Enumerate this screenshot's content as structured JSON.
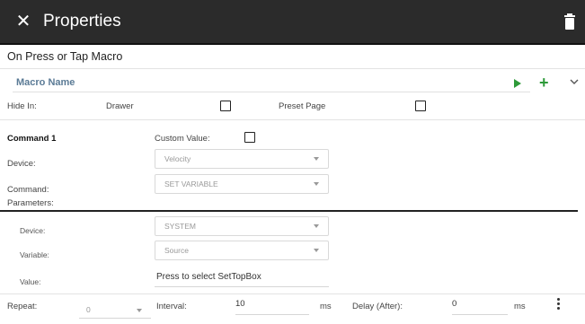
{
  "header": {
    "title": "Properties",
    "close_icon": "close-icon",
    "delete_icon": "trash-icon"
  },
  "section": {
    "title": "On Press or Tap Macro"
  },
  "macro": {
    "name_label": "Macro Name",
    "run_icon": "play-icon",
    "add_icon": "plus-icon",
    "expand_icon": "chevron-down-icon",
    "colors": {
      "label": "#5b7b96",
      "actions": "#2e9a39"
    }
  },
  "hide_in": {
    "label": "Hide In:",
    "drawer_label": "Drawer",
    "preset_label": "Preset Page",
    "drawer_checked": false,
    "preset_checked": false
  },
  "command": {
    "title": "Command 1",
    "custom_value_label": "Custom Value:",
    "custom_value_checked": false,
    "device_label": "Device:",
    "device_value": "Velocity",
    "command_label": "Command:",
    "command_value": "SET VARIABLE",
    "parameters_label": "Parameters:"
  },
  "parameters": {
    "device_label": "Device:",
    "device_value": "SYSTEM",
    "variable_label": "Variable:",
    "variable_value": "Source",
    "value_label": "Value:",
    "value_value": "Press to select SetTopBox"
  },
  "timing": {
    "repeat_label": "Repeat:",
    "repeat_value": "0",
    "interval_label": "Interval:",
    "interval_value": "10",
    "interval_unit": "ms",
    "delay_label": "Delay (After):",
    "delay_value": "0",
    "delay_unit": "ms",
    "more_icon": "more-vertical-icon"
  }
}
